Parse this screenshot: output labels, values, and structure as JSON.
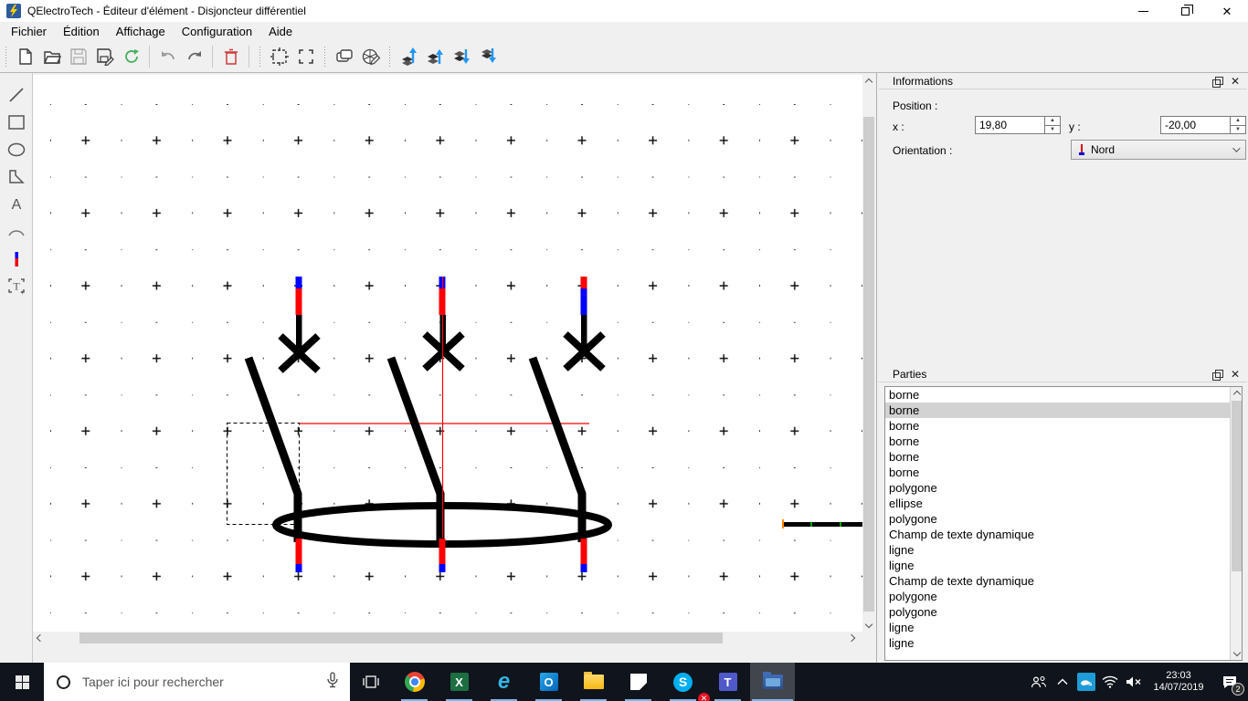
{
  "window": {
    "title": "QElectroTech - Éditeur d'élément - Disjoncteur différentiel",
    "app_icon": "qelectrotech-lightning-icon"
  },
  "menubar": {
    "items": [
      "Fichier",
      "Édition",
      "Affichage",
      "Configuration",
      "Aide"
    ]
  },
  "toolbar": {
    "icons": [
      "new-file",
      "open-folder",
      "save",
      "save-as",
      "reload",
      "undo",
      "redo",
      "delete",
      "fit-selection",
      "frame-selection",
      "edit-properties",
      "color-wheel",
      "raise-to-top",
      "raise",
      "lower",
      "lower-to-bottom"
    ]
  },
  "tool_palette": {
    "icons": [
      "line",
      "rectangle",
      "ellipse",
      "polygon",
      "text",
      "arc",
      "terminal",
      "dynamic-textfield"
    ]
  },
  "informations_panel": {
    "title": "Informations",
    "position_label": "Position :",
    "x_label": "x :",
    "x_value": "19,80",
    "y_label": "y :",
    "y_value": "-20,00",
    "orientation_label": "Orientation :",
    "orientation_value": "Nord"
  },
  "parties_panel": {
    "title": "Parties",
    "selected_index": 1,
    "items": [
      "borne",
      "borne",
      "borne",
      "borne",
      "borne",
      "borne",
      "polygone",
      "ellipse",
      "polygone",
      "Champ de texte dynamique",
      "ligne",
      "ligne",
      "Champ de texte dynamique",
      "polygone",
      "polygone",
      "ligne",
      "ligne"
    ]
  },
  "taskbar": {
    "search_placeholder": "Taper ici pour rechercher",
    "apps": [
      "chrome",
      "excel",
      "internet-explorer",
      "outlook",
      "file-explorer",
      "notes",
      "skype",
      "teams",
      "qelectrotech"
    ],
    "active_app": "qelectrotech",
    "excel_letter": "X",
    "ie_letter": "e",
    "outlook_letter": "O",
    "skype_letter": "S",
    "skype_badge": "✕",
    "teams_letter": "T",
    "tray_icons": [
      "people",
      "chevron-up",
      "zscaler",
      "wifi",
      "volume-muted"
    ],
    "time": "23:03",
    "date": "14/07/2019",
    "notification_count": "2"
  },
  "colors": {
    "terminal_red": "#ff0000",
    "terminal_blue": "#0000ff",
    "crosshair_red": "#ff0000",
    "taskbar_underline": "#79b8ea"
  }
}
